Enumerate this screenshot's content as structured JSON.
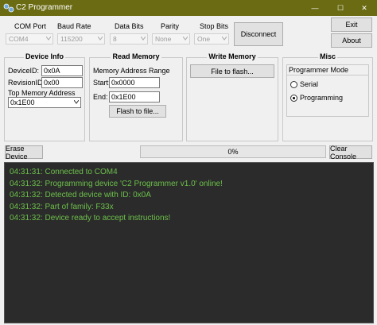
{
  "window": {
    "title": "C2 Programmer",
    "controls": [
      "—",
      "☐",
      "✕"
    ]
  },
  "colors": {
    "titlebar": "#6b6b14",
    "console_bg": "#2b2b2b",
    "console_text": "#6cc04a"
  },
  "serial": {
    "labels": {
      "com_port": "COM Port",
      "baud_rate": "Baud Rate",
      "data_bits": "Data Bits",
      "parity": "Parity",
      "stop_bits": "Stop Bits"
    },
    "values": {
      "com_port": "COM4",
      "baud_rate": "115200",
      "data_bits": "8",
      "parity": "None",
      "stop_bits": "One"
    },
    "disconnect_label": "Disconnect"
  },
  "buttons": {
    "exit": "Exit",
    "about": "About",
    "erase_device": "Erase Device",
    "clear_console": "Clear Console"
  },
  "device_info": {
    "title": "Device Info",
    "device_id_label": "DeviceID:",
    "device_id": "0x0A",
    "revision_id_label": "RevisionID:",
    "revision_id": "0x00",
    "top_addr_label": "Top Memory Address",
    "top_addr": "0x1E00"
  },
  "read_memory": {
    "title": "Read Memory",
    "range_label": "Memory Address Range",
    "start_label": "Start:",
    "start": "0x0000",
    "end_label": "End:",
    "end": "0x1E00",
    "flash_to_file": "Flash to file..."
  },
  "write_memory": {
    "title": "Write Memory",
    "file_to_flash": "File to flash..."
  },
  "misc": {
    "title": "Misc",
    "mode_label": "Programmer Mode",
    "serial": "Serial",
    "programming": "Programming",
    "selected": "Programming"
  },
  "progress": {
    "text": "0%",
    "value": 0
  },
  "console": {
    "lines": [
      {
        "time": "04:31:31:",
        "msg": "Connected to COM4"
      },
      {
        "time": "04:31:32:",
        "msg": "Programming device 'C2 Programmer v1.0' online!"
      },
      {
        "time": "04:31:32:",
        "msg": "Detected device with ID: 0x0A"
      },
      {
        "time": "04:31:32:",
        "msg": "Part of family: F33x"
      },
      {
        "time": "04:31:32:",
        "msg": "Device ready to accept instructions!"
      }
    ]
  }
}
